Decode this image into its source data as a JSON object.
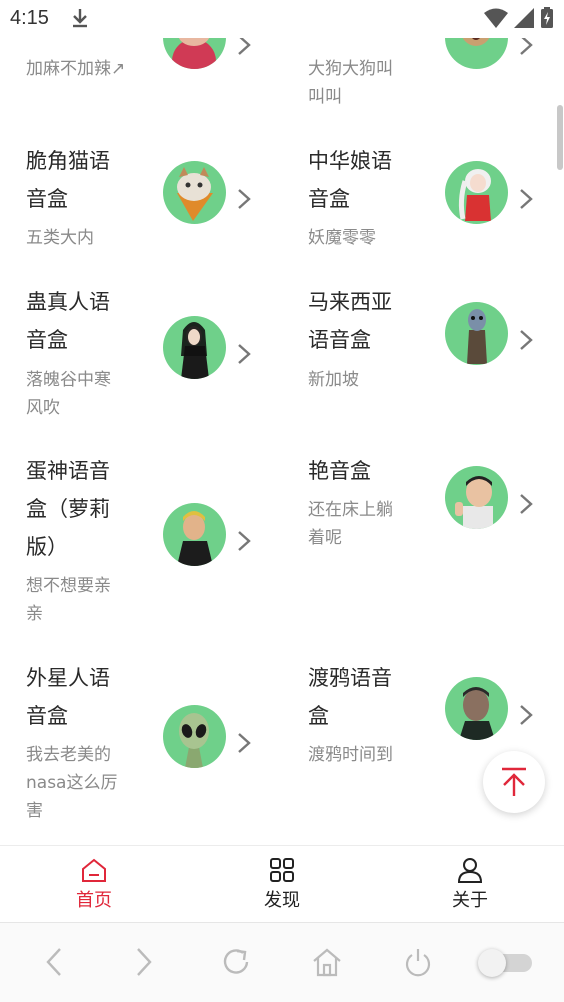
{
  "status": {
    "time": "4:15"
  },
  "cards": [
    {
      "name": "",
      "desc": "加麻不加辣↗"
    },
    {
      "name": "",
      "desc": "大狗大狗叫叫叫"
    },
    {
      "name": "脆角猫语音盒",
      "desc": "五类大内"
    },
    {
      "name": "中华娘语音盒",
      "desc": "妖魔零零"
    },
    {
      "name": "蛊真人语音盒",
      "desc": "落魄谷中寒风吹"
    },
    {
      "name": "马来西亚语音盒",
      "desc": "新加坡"
    },
    {
      "name": "蛋神语音盒（萝莉版）",
      "desc": "想不想要亲亲"
    },
    {
      "name": "艳音盒",
      "desc": "还在床上躺着呢"
    },
    {
      "name": "外星人语音盒",
      "desc": "我去老美的nasa这么厉害"
    },
    {
      "name": "渡鸦语音盒",
      "desc": "渡鸦时间到"
    }
  ],
  "tabs": [
    {
      "label": "首页",
      "icon": "home-icon",
      "active": true
    },
    {
      "label": "发现",
      "icon": "grid-icon",
      "active": false
    },
    {
      "label": "关于",
      "icon": "user-icon",
      "active": false
    }
  ],
  "colors": {
    "accent": "#e0273a",
    "avatar_bg": "#6fd08a"
  }
}
